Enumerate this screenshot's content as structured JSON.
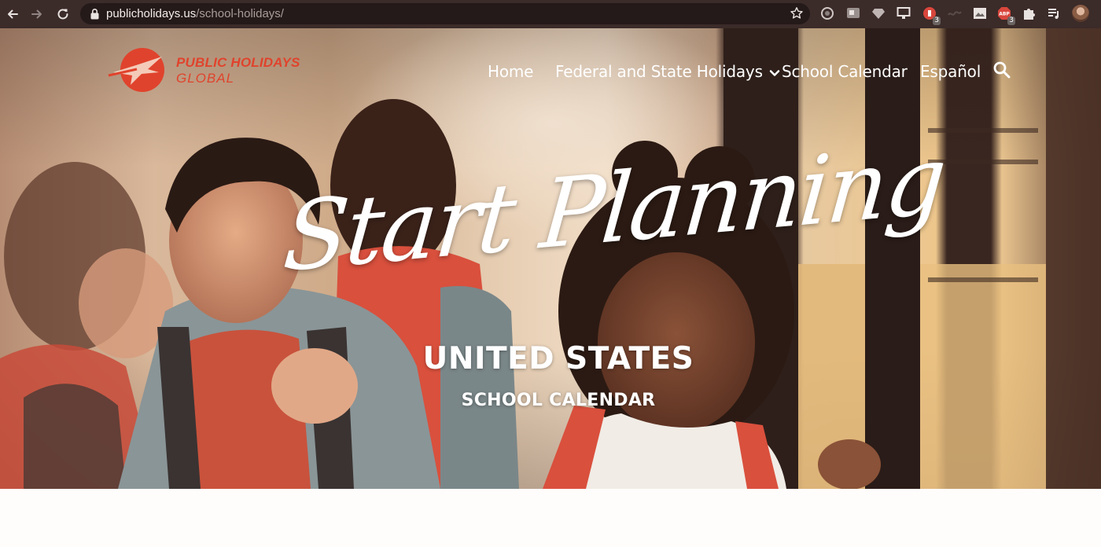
{
  "browser": {
    "url_domain": "publicholidays.us",
    "url_path": "/school-holidays/",
    "extensions": [
      {
        "icon": "circle-extension-icon"
      },
      {
        "icon": "translate-extension-icon"
      },
      {
        "icon": "diamond-extension-icon"
      },
      {
        "icon": "monitor-extension-icon"
      },
      {
        "icon": "red-badge-extension-icon",
        "badge": "3"
      },
      {
        "icon": "wave-extension-icon"
      },
      {
        "icon": "screenshot-extension-icon"
      },
      {
        "icon": "adblock-extension-icon",
        "badge": "3"
      },
      {
        "icon": "puzzle-extensions-icon"
      },
      {
        "icon": "media-queue-icon"
      }
    ]
  },
  "site": {
    "logo_line1": "PUBLIC HOLIDAYS",
    "logo_line2": "GLOBAL",
    "brand_color": "#e0432d",
    "menu": {
      "home": "Home",
      "federal": "Federal and State Holidays",
      "school": "School Calendar",
      "espanol": "Español"
    }
  },
  "hero": {
    "script_title": "Start Planning",
    "title": "UNITED STATES",
    "subtitle": "SCHOOL CALENDAR"
  }
}
